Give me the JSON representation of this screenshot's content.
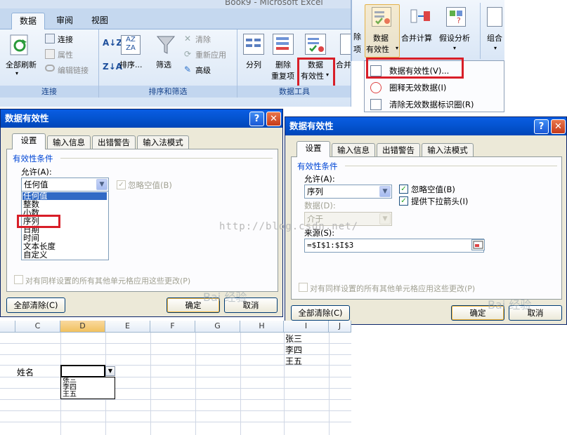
{
  "ribbon": {
    "window_title": "Book9 - Microsoft Excel",
    "tabs": [
      "数据",
      "审阅",
      "视图"
    ],
    "groups": {
      "connections": {
        "label": "连接",
        "refresh_all": "全部刷新",
        "connections": "连接",
        "properties": "属性",
        "edit_links": "编辑链接"
      },
      "sort_filter": {
        "label": "排序和筛选",
        "sort": "排序...",
        "filter": "筛选",
        "clear": "清除",
        "reapply": "重新应用",
        "advanced": "高级"
      },
      "data_tools": {
        "label": "数据工具",
        "split": "分列",
        "remove_dup_1": "删除",
        "remove_dup_2": "重复项",
        "validation_1": "数据",
        "validation_2": "有效性",
        "merge_partial": "合并"
      }
    }
  },
  "snippet": {
    "partial_left_1": "除",
    "partial_left_2": "项",
    "validation_1": "数据",
    "validation_2": "有效性",
    "consolidate": "合并计算",
    "whatif": "假设分析",
    "group": "组合"
  },
  "menu": {
    "items": [
      "数据有效性(V)...",
      "圈释无效数据(I)",
      "清除无效数据标识圈(R)"
    ]
  },
  "dialog_left": {
    "title": "数据有效性",
    "help": "?",
    "close": "✕",
    "tabs": [
      "设置",
      "输入信息",
      "出错警告",
      "输入法模式"
    ],
    "section": "有效性条件",
    "allow_label": "允许(A):",
    "allow_value": "任何值",
    "ignore_blank": "忽略空值(B)",
    "list_options": [
      "任何值",
      "整数",
      "小数",
      "序列",
      "日期",
      "时间",
      "文本长度",
      "自定义"
    ],
    "apply_all": "对有同样设置的所有其他单元格应用这些更改(P)",
    "clear_all": "全部清除(C)",
    "ok": "确定",
    "cancel": "取消"
  },
  "dialog_right": {
    "title": "数据有效性",
    "help": "?",
    "close": "✕",
    "tabs": [
      "设置",
      "输入信息",
      "出错警告",
      "输入法模式"
    ],
    "section": "有效性条件",
    "allow_label": "允许(A):",
    "allow_value": "序列",
    "ignore_blank": "忽略空值(B)",
    "dropdown_arrow": "提供下拉箭头(I)",
    "data_label": "数据(D):",
    "data_value": "介于",
    "source_label": "来源(S):",
    "source_value": "=$I$1:$I$3",
    "apply_all": "对有同样设置的所有其他单元格应用这些更改(P)",
    "clear_all": "全部清除(C)",
    "ok": "确定",
    "cancel": "取消"
  },
  "watermarks": {
    "url": "http://blog.csdn.net/",
    "baidu_left": "Bai 经验",
    "baidu_right": "Bai 经验"
  },
  "sheet": {
    "columns": [
      "C",
      "D",
      "E",
      "F",
      "G",
      "H",
      "I",
      "J"
    ],
    "list_values": [
      "张三",
      "李四",
      "王五"
    ],
    "name_label": "姓名",
    "dropdown_items": [
      "张三",
      "李四",
      "王五"
    ]
  },
  "colors": {
    "highlight_red": "#d81e28",
    "xp_title_blue": "#0453cf",
    "ribbon_blue": "#dbe6f4"
  }
}
